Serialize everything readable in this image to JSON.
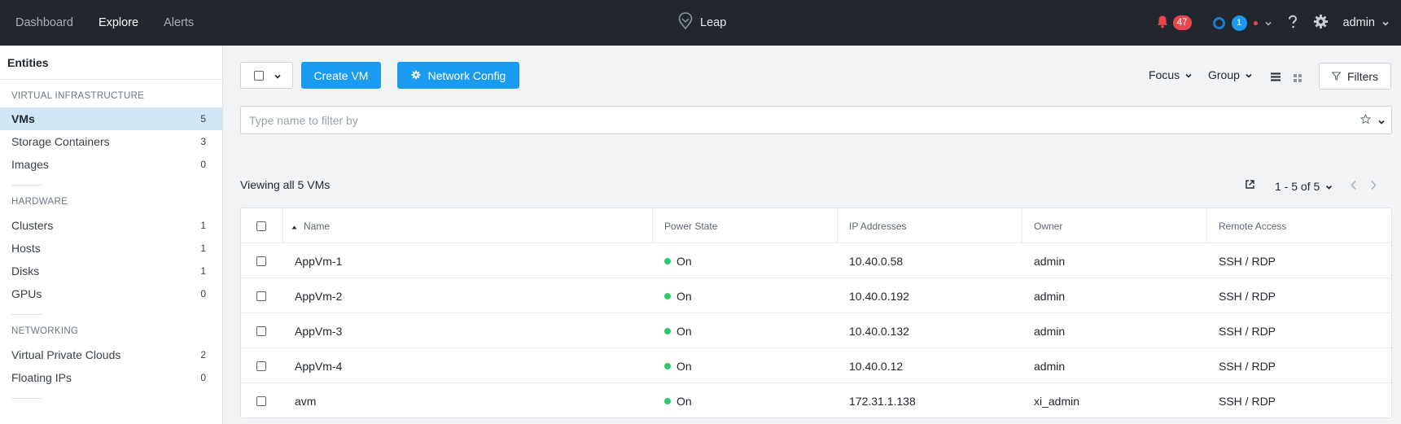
{
  "topbar": {
    "nav": [
      "Dashboard",
      "Explore",
      "Alerts"
    ],
    "brand": "Leap",
    "alerts_count": "47",
    "tasks_count": "1",
    "user": "admin"
  },
  "sidebar": {
    "title": "Entities",
    "sections": [
      {
        "label": "VIRTUAL INFRASTRUCTURE",
        "items": [
          {
            "label": "VMs",
            "count": "5"
          },
          {
            "label": "Storage Containers",
            "count": "3"
          },
          {
            "label": "Images",
            "count": "0"
          }
        ]
      },
      {
        "label": "HARDWARE",
        "items": [
          {
            "label": "Clusters",
            "count": "1"
          },
          {
            "label": "Hosts",
            "count": "1"
          },
          {
            "label": "Disks",
            "count": "1"
          },
          {
            "label": "GPUs",
            "count": "0"
          }
        ]
      },
      {
        "label": "NETWORKING",
        "items": [
          {
            "label": "Virtual Private Clouds",
            "count": "2"
          },
          {
            "label": "Floating IPs",
            "count": "0"
          }
        ]
      }
    ]
  },
  "toolbar": {
    "create_vm": "Create VM",
    "network_config": "Network Config",
    "focus": "Focus",
    "group": "Group",
    "filters": "Filters"
  },
  "search": {
    "placeholder": "Type name to filter by"
  },
  "viewing_label": "Viewing all 5 VMs",
  "pagination": "1 - 5 of 5",
  "table": {
    "columns": [
      "Name",
      "Power State",
      "IP Addresses",
      "Owner",
      "Remote Access"
    ],
    "rows": [
      {
        "name": "AppVm-1",
        "power": "On",
        "ip": "10.40.0.58",
        "owner": "admin",
        "access": "SSH / RDP"
      },
      {
        "name": "AppVm-2",
        "power": "On",
        "ip": "10.40.0.192",
        "owner": "admin",
        "access": "SSH / RDP"
      },
      {
        "name": "AppVm-3",
        "power": "On",
        "ip": "10.40.0.132",
        "owner": "admin",
        "access": "SSH / RDP"
      },
      {
        "name": "AppVm-4",
        "power": "On",
        "ip": "10.40.0.12",
        "owner": "admin",
        "access": "SSH / RDP"
      },
      {
        "name": "avm",
        "power": "On",
        "ip": "172.31.1.138",
        "owner": "xi_admin",
        "access": "SSH / RDP"
      }
    ]
  },
  "colors": {
    "topbar": "#22272e",
    "primary": "#1b9bf0",
    "alert": "#e8474e",
    "power_on": "#2cc96b",
    "active_nav": "#d0e7f8"
  }
}
